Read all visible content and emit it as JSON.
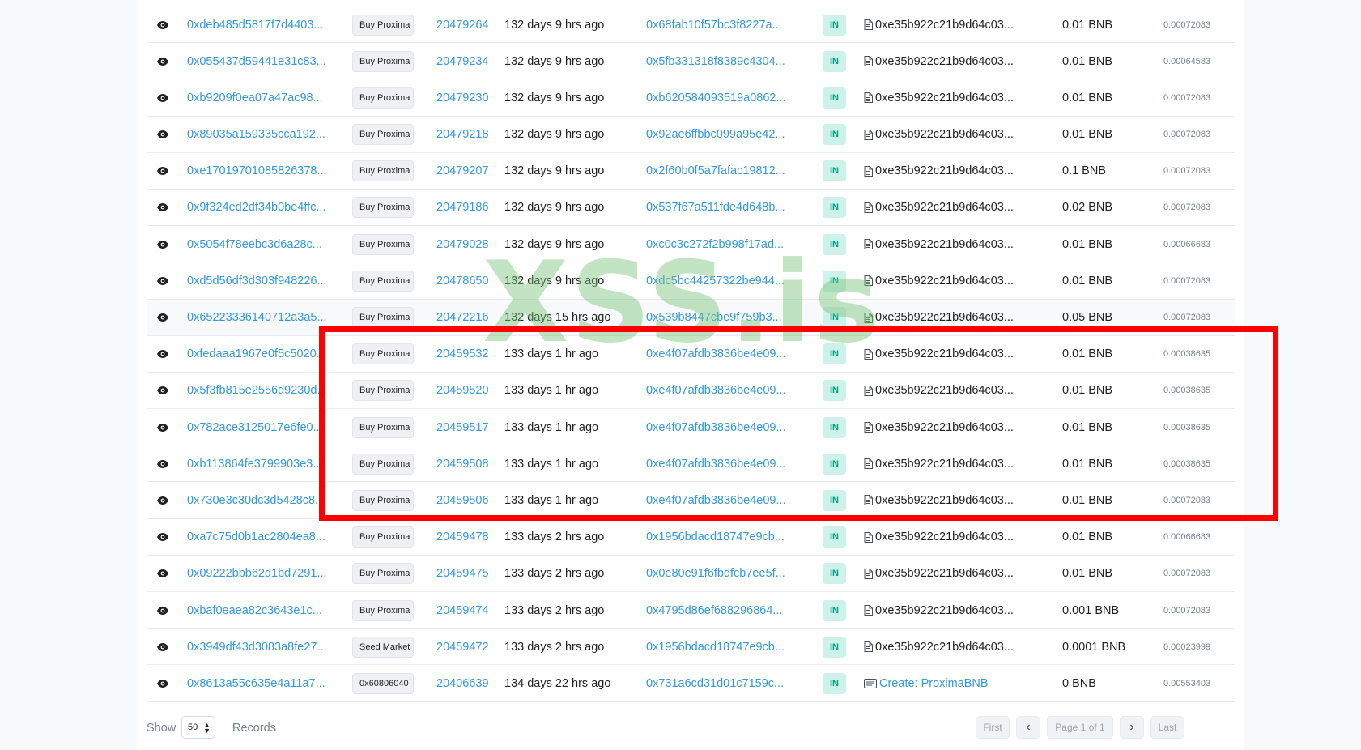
{
  "rows": [
    {
      "tx": "0xdeb485d5817f7d4403...",
      "method": "Buy Proxima",
      "block": "20479264",
      "age": "132 days 9 hrs ago",
      "from": "0x68fab10f57bc3f8227a...",
      "direction": "IN",
      "to": "0xe35b922c21b9d64c03...",
      "value": "0.01 BNB",
      "fee": "0.00072083"
    },
    {
      "tx": "0x055437d59441e31c83...",
      "method": "Buy Proxima",
      "block": "20479234",
      "age": "132 days 9 hrs ago",
      "from": "0x5fb331318f8389c4304...",
      "direction": "IN",
      "to": "0xe35b922c21b9d64c03...",
      "value": "0.01 BNB",
      "fee": "0.00064583"
    },
    {
      "tx": "0xb9209f0ea07a47ac98...",
      "method": "Buy Proxima",
      "block": "20479230",
      "age": "132 days 9 hrs ago",
      "from": "0xb620584093519a0862...",
      "direction": "IN",
      "to": "0xe35b922c21b9d64c03...",
      "value": "0.01 BNB",
      "fee": "0.00072083"
    },
    {
      "tx": "0x89035a159335cca192...",
      "method": "Buy Proxima",
      "block": "20479218",
      "age": "132 days 9 hrs ago",
      "from": "0x92ae6ffbbc099a95e42...",
      "direction": "IN",
      "to": "0xe35b922c21b9d64c03...",
      "value": "0.01 BNB",
      "fee": "0.00072083"
    },
    {
      "tx": "0xe17019701085826378...",
      "method": "Buy Proxima",
      "block": "20479207",
      "age": "132 days 9 hrs ago",
      "from": "0x2f60b0f5a7fafac19812...",
      "direction": "IN",
      "to": "0xe35b922c21b9d64c03...",
      "value": "0.1 BNB",
      "fee": "0.00072083"
    },
    {
      "tx": "0x9f324ed2df34b0be4ffc...",
      "method": "Buy Proxima",
      "block": "20479186",
      "age": "132 days 9 hrs ago",
      "from": "0x537f67a511fde4d648b...",
      "direction": "IN",
      "to": "0xe35b922c21b9d64c03...",
      "value": "0.02 BNB",
      "fee": "0.00072083"
    },
    {
      "tx": "0x5054f78eebc3d6a28c...",
      "method": "Buy Proxima",
      "block": "20479028",
      "age": "132 days 9 hrs ago",
      "from": "0xc0c3c272f2b998f17ad...",
      "direction": "IN",
      "to": "0xe35b922c21b9d64c03...",
      "value": "0.01 BNB",
      "fee": "0.00066683"
    },
    {
      "tx": "0xd5d56df3d303f948226...",
      "method": "Buy Proxima",
      "block": "20478650",
      "age": "132 days 9 hrs ago",
      "from": "0xdc5bc44257322be944...",
      "direction": "IN",
      "to": "0xe35b922c21b9d64c03...",
      "value": "0.01 BNB",
      "fee": "0.00072083"
    },
    {
      "tx": "0x65223336140712a3a5...",
      "method": "Buy Proxima",
      "block": "20472216",
      "age": "132 days 15 hrs ago",
      "from": "0x539b8447cbe9f759b3...",
      "direction": "IN",
      "to": "0xe35b922c21b9d64c03...",
      "value": "0.05 BNB",
      "fee": "0.00072083",
      "highlight": true
    },
    {
      "tx": "0xfedaaa1967e0f5c5020...",
      "method": "Buy Proxima",
      "block": "20459532",
      "age": "133 days 1 hr ago",
      "from": "0xe4f07afdb3836be4e09...",
      "direction": "IN",
      "to": "0xe35b922c21b9d64c03...",
      "value": "0.01 BNB",
      "fee": "0.00038635"
    },
    {
      "tx": "0x5f3fb815e2556d9230d...",
      "method": "Buy Proxima",
      "block": "20459520",
      "age": "133 days 1 hr ago",
      "from": "0xe4f07afdb3836be4e09...",
      "direction": "IN",
      "to": "0xe35b922c21b9d64c03...",
      "value": "0.01 BNB",
      "fee": "0.00038635"
    },
    {
      "tx": "0x782ace3125017e6fe0...",
      "method": "Buy Proxima",
      "block": "20459517",
      "age": "133 days 1 hr ago",
      "from": "0xe4f07afdb3836be4e09...",
      "direction": "IN",
      "to": "0xe35b922c21b9d64c03...",
      "value": "0.01 BNB",
      "fee": "0.00038635"
    },
    {
      "tx": "0xb113864fe3799903e3...",
      "method": "Buy Proxima",
      "block": "20459508",
      "age": "133 days 1 hr ago",
      "from": "0xe4f07afdb3836be4e09...",
      "direction": "IN",
      "to": "0xe35b922c21b9d64c03...",
      "value": "0.01 BNB",
      "fee": "0.00038635"
    },
    {
      "tx": "0x730e3c30dc3d5428c8...",
      "method": "Buy Proxima",
      "block": "20459506",
      "age": "133 days 1 hr ago",
      "from": "0xe4f07afdb3836be4e09...",
      "direction": "IN",
      "to": "0xe35b922c21b9d64c03...",
      "value": "0.01 BNB",
      "fee": "0.00072083"
    },
    {
      "tx": "0xa7c75d0b1ac2804ea8...",
      "method": "Buy Proxima",
      "block": "20459478",
      "age": "133 days 2 hrs ago",
      "from": "0x1956bdacd18747e9cb...",
      "direction": "IN",
      "to": "0xe35b922c21b9d64c03...",
      "value": "0.01 BNB",
      "fee": "0.00066683"
    },
    {
      "tx": "0x09222bbb62d1bd7291...",
      "method": "Buy Proxima",
      "block": "20459475",
      "age": "133 days 2 hrs ago",
      "from": "0x0e80e91f6fbdfcb7ee5f...",
      "direction": "IN",
      "to": "0xe35b922c21b9d64c03...",
      "value": "0.01 BNB",
      "fee": "0.00072083"
    },
    {
      "tx": "0xbaf0eaea82c3643e1c...",
      "method": "Buy Proxima",
      "block": "20459474",
      "age": "133 days 2 hrs ago",
      "from": "0x4795d86ef688296864...",
      "direction": "IN",
      "to": "0xe35b922c21b9d64c03...",
      "value": "0.001 BNB",
      "fee": "0.00072083"
    },
    {
      "tx": "0x3949df43d3083a8fe27...",
      "method": "Seed Market",
      "block": "20459472",
      "age": "133 days 2 hrs ago",
      "from": "0x1956bdacd18747e9cb...",
      "direction": "IN",
      "to": "0xe35b922c21b9d64c03...",
      "value": "0.0001 BNB",
      "fee": "0.00023999"
    },
    {
      "tx": "0x8613a55c635e4a11a7...",
      "method": "0x60806040",
      "block": "20406639",
      "age": "134 days 22 hrs ago",
      "from": "0x731a6cd31d01c7159c...",
      "direction": "IN",
      "to": "Create: ProximaBNB",
      "to_is_create": true,
      "value": "0 BNB",
      "fee": "0.00553403"
    }
  ],
  "footer": {
    "show_label": "Show",
    "records_selected": "50",
    "records_label": "Records",
    "first": "First",
    "prev": "‹",
    "page_info": "Page 1 of 1",
    "next": "›",
    "last": "Last"
  },
  "watermark": "XSS.is",
  "colors": {
    "link": "#3498db",
    "direction_bg": "#cdf2e9",
    "direction_text": "#00a186",
    "annotation": "#ff0000",
    "watermark": "#78c478"
  },
  "icons": {
    "view": "eye-icon",
    "contract": "document-icon",
    "create_contract": "contract-create-icon"
  }
}
